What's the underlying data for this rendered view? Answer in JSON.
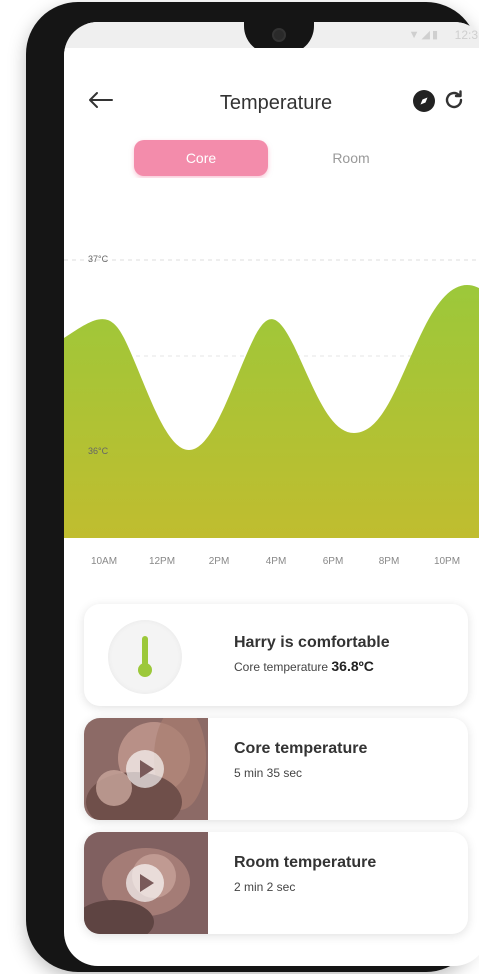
{
  "status": {
    "time": "12:3",
    "icons": "▼◢▮"
  },
  "header": {
    "title": "Temperature",
    "tabs": [
      {
        "label": "Core",
        "active": true
      },
      {
        "label": "Room",
        "active": false
      }
    ]
  },
  "chart_data": {
    "type": "area",
    "x": [
      "10AM",
      "12PM",
      "2PM",
      "4PM",
      "6PM",
      "8PM",
      "10PM"
    ],
    "y_ticks": [
      "37°C",
      "36°C"
    ],
    "ylim": [
      35.2,
      37.3
    ],
    "colors": {
      "top": "#9cc83a",
      "bottom": "#c0bd2f"
    }
  },
  "status_card": {
    "title": "Harry is comfortable",
    "sub_label": "Core temperature",
    "sub_value": "36.8ºC"
  },
  "videos": [
    {
      "title": "Core temperature",
      "duration": "5 min 35 sec"
    },
    {
      "title": "Room temperature",
      "duration": "2 min 2 sec"
    }
  ],
  "colors": {
    "accent": "#f38cab"
  }
}
